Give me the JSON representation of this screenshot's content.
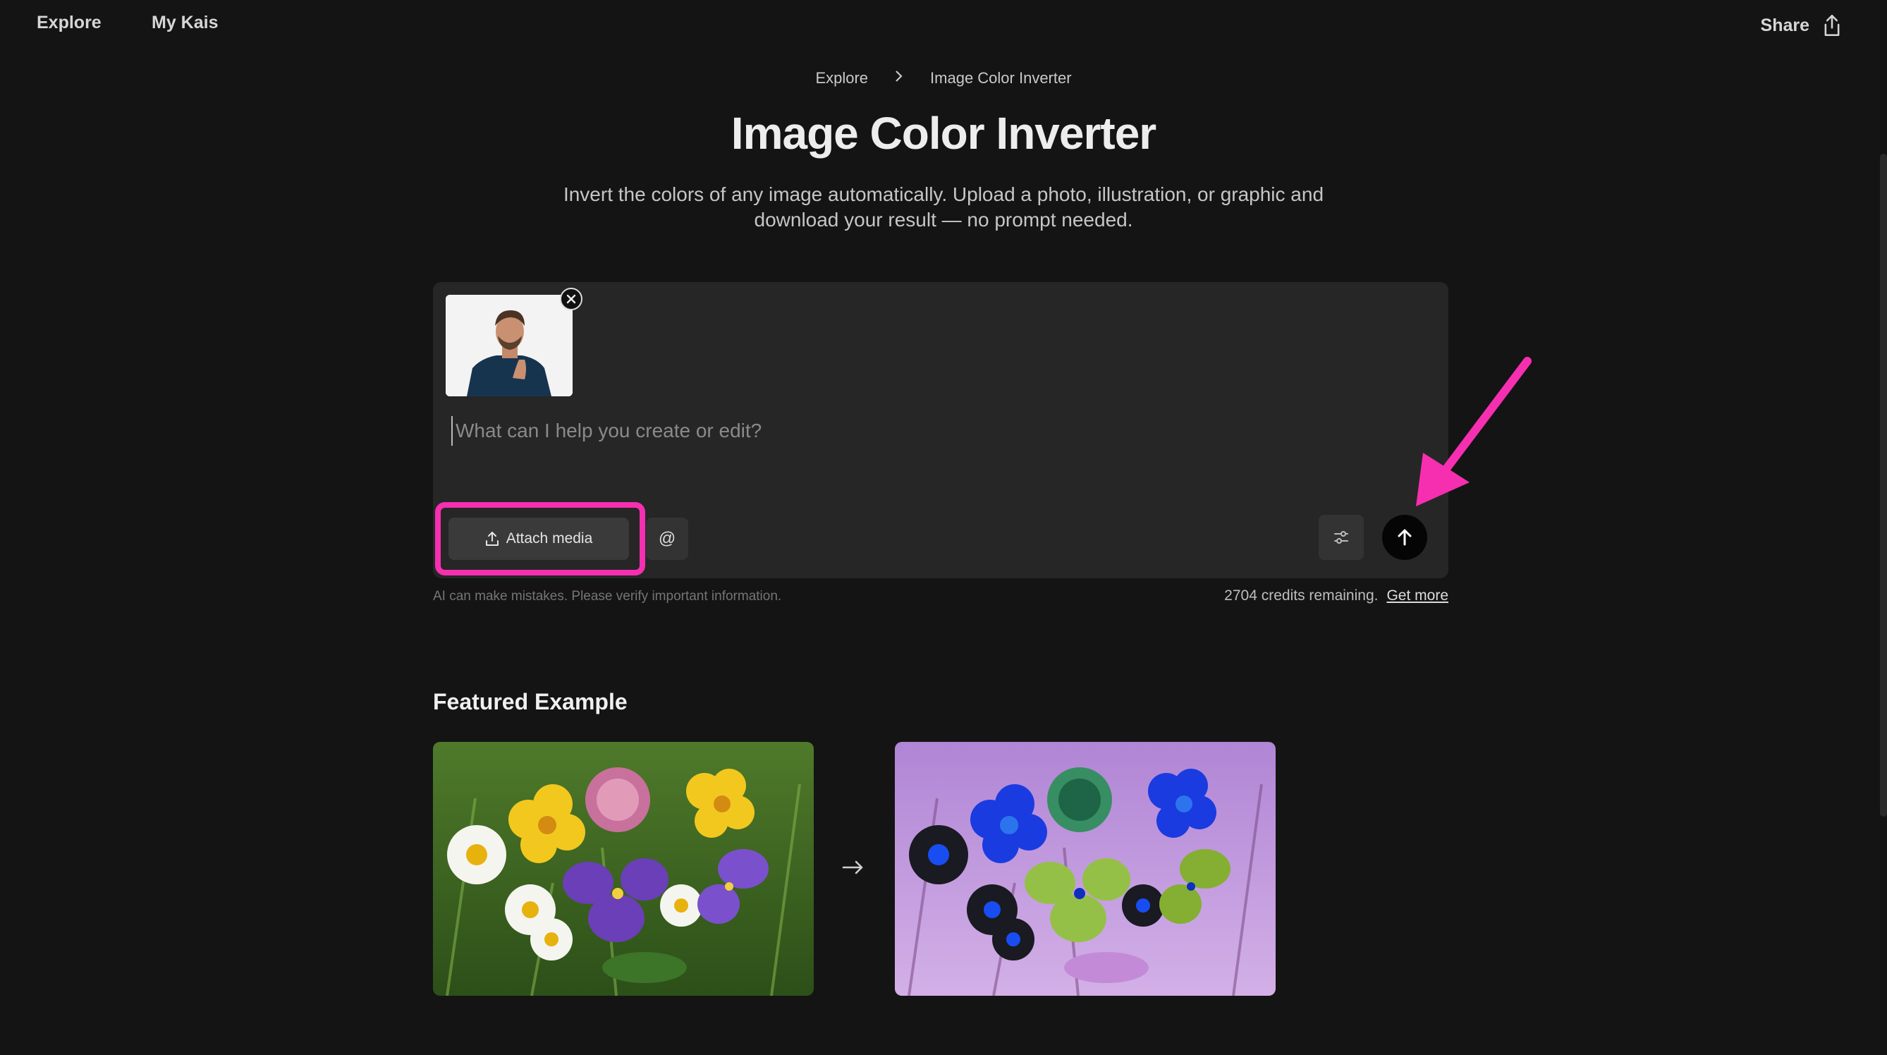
{
  "nav": {
    "explore": "Explore",
    "my_kais": "My Kais",
    "share": "Share"
  },
  "breadcrumb": {
    "root": "Explore",
    "current": "Image Color Inverter"
  },
  "page": {
    "title": "Image Color Inverter",
    "subtitle": "Invert the colors of any image automatically. Upload a photo, illustration, or graphic and download your result — no prompt needed."
  },
  "prompt": {
    "placeholder": "What can I help you create or edit?",
    "value": "",
    "attach_label": "Attach media",
    "mention_label": "@"
  },
  "footer": {
    "disclaimer": "AI can make mistakes. Please verify important information.",
    "credits": "2704 credits remaining.",
    "get_more": "Get more"
  },
  "featured": {
    "title": "Featured Example"
  },
  "colors": {
    "background": "#141414",
    "card": "#262626",
    "highlight": "#f62fb1"
  },
  "icons": [
    "share-icon",
    "chevron-right-icon",
    "close-icon",
    "upload-icon",
    "sliders-icon",
    "arrow-up-icon",
    "arrow-right-icon"
  ]
}
